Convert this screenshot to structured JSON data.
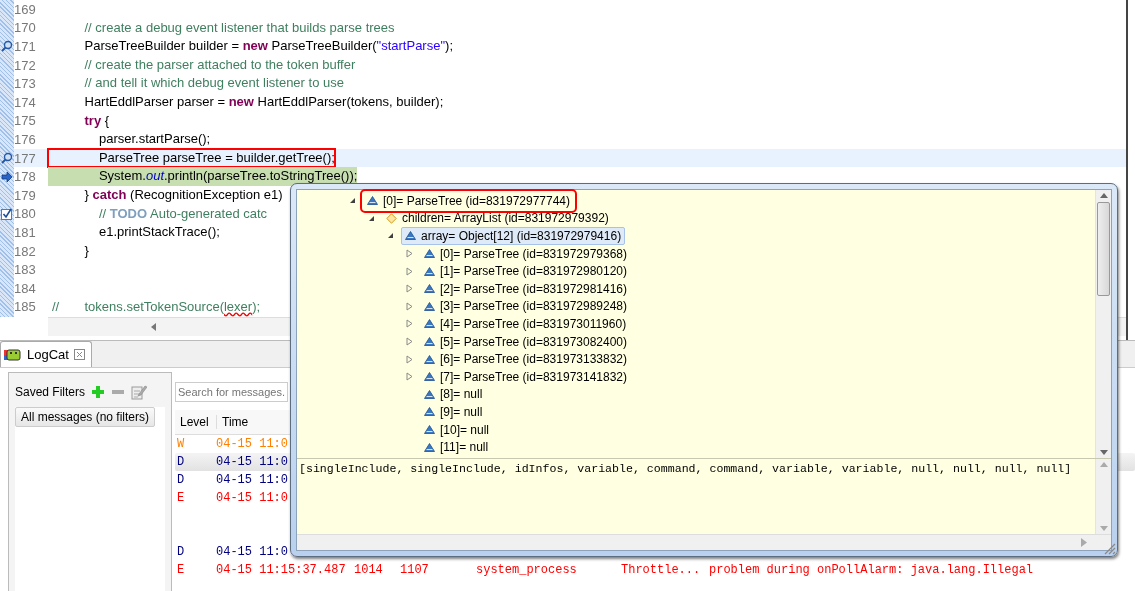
{
  "editor": {
    "lines": [
      {
        "number": "169",
        "kind": "plain",
        "cursor_line": false
      },
      {
        "number": "170",
        "kind": "plain",
        "cursor_line": false,
        "execution_line": false,
        "annotated": false,
        "tokens": [
          {
            "text": "         // create a debug event listener that builds parse trees",
            "kind": "comment"
          }
        ]
      },
      {
        "number": "171",
        "kind": "breakpoint",
        "cursor_line": false,
        "execution_line": false,
        "annotated": false,
        "tokens": [
          {
            "text": "         ParseTreeBuilder builder = ",
            "kind": "plain"
          },
          {
            "text": "new",
            "kind": "keyword"
          },
          {
            "text": " ParseTreeBuilder(",
            "kind": "plain"
          },
          {
            "text": "\"startParse\"",
            "kind": "string"
          },
          {
            "text": ");",
            "kind": "plain"
          }
        ]
      },
      {
        "number": "172",
        "kind": "plain",
        "cursor_line": false,
        "execution_line": false,
        "annotated": false,
        "tokens": [
          {
            "text": "         // create the parser attached to the token buffer",
            "kind": "comment"
          }
        ]
      },
      {
        "number": "173",
        "kind": "plain",
        "cursor_line": false,
        "execution_line": false,
        "annotated": false,
        "tokens": [
          {
            "text": "         // and tell it which debug event listener to use",
            "kind": "comment"
          }
        ]
      },
      {
        "number": "174",
        "kind": "plain",
        "cursor_line": false,
        "execution_line": false,
        "annotated": false,
        "tokens": [
          {
            "text": "         HartEddlParser parser = ",
            "kind": "plain"
          },
          {
            "text": "new",
            "kind": "keyword"
          },
          {
            "text": " HartEddlParser(tokens, builder);",
            "kind": "plain"
          }
        ]
      },
      {
        "number": "175",
        "kind": "plain",
        "cursor_line": false,
        "execution_line": false,
        "annotated": false,
        "tokens": [
          {
            "text": "         try",
            "kind": "keyword"
          },
          {
            "text": " {",
            "kind": "plain"
          }
        ]
      },
      {
        "number": "176",
        "kind": "plain",
        "cursor_line": false,
        "execution_line": false,
        "annotated": false,
        "tokens": [
          {
            "text": "             parser.startParse();",
            "kind": "plain"
          }
        ]
      },
      {
        "number": "177",
        "kind": "breakpoint",
        "cursor_line": true,
        "execution_line": false,
        "annotated": true,
        "tokens": [
          {
            "text": "             ParseTree parseTree = builder.getTree();",
            "kind": "plain"
          }
        ]
      },
      {
        "number": "178",
        "kind": "instruction_pointer",
        "cursor_line": false,
        "execution_line": true,
        "annotated": false,
        "tokens": [
          {
            "text": "             System.",
            "kind": "plain"
          },
          {
            "text": "out",
            "kind": "static_field"
          },
          {
            "text": ".println(parseTree.toStringTree());",
            "kind": "plain"
          }
        ]
      },
      {
        "number": "179",
        "kind": "plain",
        "cursor_line": false,
        "execution_line": false,
        "annotated": false,
        "tokens": [
          {
            "text": "         } ",
            "kind": "plain"
          },
          {
            "text": "catch",
            "kind": "keyword"
          },
          {
            "text": " (RecognitionException e1)",
            "kind": "plain"
          }
        ]
      },
      {
        "number": "180",
        "kind": "task",
        "cursor_line": false,
        "execution_line": false,
        "annotated": false,
        "tokens": [
          {
            "text": "             // ",
            "kind": "comment"
          },
          {
            "text": "TODO",
            "kind": "todo"
          },
          {
            "text": " Auto-generated catc",
            "kind": "comment"
          }
        ]
      },
      {
        "number": "181",
        "kind": "plain",
        "cursor_line": false,
        "execution_line": false,
        "annotated": false,
        "tokens": [
          {
            "text": "             e1.printStackTrace();",
            "kind": "plain"
          }
        ]
      },
      {
        "number": "182",
        "kind": "plain",
        "cursor_line": false,
        "execution_line": false,
        "annotated": false,
        "tokens": [
          {
            "text": "         }",
            "kind": "plain"
          }
        ]
      },
      {
        "number": "183",
        "kind": "plain",
        "cursor_line": false
      },
      {
        "number": "184",
        "kind": "plain",
        "cursor_line": false
      },
      {
        "number": "185",
        "kind": "plain",
        "cursor_line": false,
        "execution_line": false,
        "annotated": false,
        "tokens": [
          {
            "text": "//       tokens.setTokenSource(",
            "kind": "comment"
          },
          {
            "text": "lexer",
            "kind": "comment_warning"
          },
          {
            "text": ");",
            "kind": "comment"
          }
        ]
      }
    ]
  },
  "logcat": {
    "tab": {
      "label": "LogCat"
    },
    "filters": {
      "title": "Saved Filters",
      "items": [
        {
          "label": "All messages (no filters)",
          "selected": true
        }
      ]
    },
    "search": {
      "placeholder": "Search for messages."
    },
    "columns": [
      "Level",
      "Time"
    ],
    "rows": [
      {
        "kind": "entry",
        "level": "W",
        "time": "04-15 11:0",
        "color": "#ff8000",
        "selected": false
      },
      {
        "kind": "entry",
        "level": "D",
        "time": "04-15 11:0",
        "color": "#00007f",
        "selected": true
      },
      {
        "kind": "entry",
        "level": "D",
        "time": "04-15 11:0",
        "color": "#00007f",
        "selected": false
      },
      {
        "kind": "entry",
        "level": "E",
        "time": "04-15 11:0",
        "color": "#ff0000",
        "selected": false
      },
      {
        "kind": "blank"
      },
      {
        "kind": "blank"
      },
      {
        "kind": "entry",
        "level": "D",
        "time": "04-15 11:0",
        "color": "#00007f",
        "selected": false
      },
      {
        "kind": "full",
        "level": "E",
        "time": "04-15 11:15:37.487",
        "pid": "1014",
        "tid": "1107",
        "application": "system_process",
        "tag": "Throttle...",
        "text": "problem during onPollAlarm: java.lang.Illegal",
        "color": "#ff0000",
        "selected": false
      }
    ]
  },
  "inspector": {
    "tree": [
      {
        "label": "[0]= ParseTree  (id=831972977744)",
        "kind": "public",
        "expandable": true,
        "expanded": true,
        "selected": false,
        "annotated": true,
        "children": [
          {
            "label": "children= ArrayList  (id=831972979392)",
            "kind": "protected",
            "expandable": true,
            "expanded": true,
            "selected": false,
            "annotated": false,
            "children": [
              {
                "label": "array= Object[12]  (id=831972979416)",
                "kind": "public",
                "expandable": true,
                "expanded": true,
                "selected": true,
                "annotated": false,
                "children": [
                  {
                    "label": "[0]= ParseTree  (id=831972979368)",
                    "kind": "public",
                    "expandable": true,
                    "expanded": false,
                    "selected": false,
                    "annotated": false
                  },
                  {
                    "label": "[1]= ParseTree  (id=831972980120)",
                    "kind": "public",
                    "expandable": true,
                    "expanded": false,
                    "selected": false,
                    "annotated": false
                  },
                  {
                    "label": "[2]= ParseTree  (id=831972981416)",
                    "kind": "public",
                    "expandable": true,
                    "expanded": false,
                    "selected": false,
                    "annotated": false
                  },
                  {
                    "label": "[3]= ParseTree  (id=831972989248)",
                    "kind": "public",
                    "expandable": true,
                    "expanded": false,
                    "selected": false,
                    "annotated": false
                  },
                  {
                    "label": "[4]= ParseTree  (id=831973011960)",
                    "kind": "public",
                    "expandable": true,
                    "expanded": false,
                    "selected": false,
                    "annotated": false
                  },
                  {
                    "label": "[5]= ParseTree  (id=831973082400)",
                    "kind": "public",
                    "expandable": true,
                    "expanded": false,
                    "selected": false,
                    "annotated": false
                  },
                  {
                    "label": "[6]= ParseTree  (id=831973133832)",
                    "kind": "public",
                    "expandable": true,
                    "expanded": false,
                    "selected": false,
                    "annotated": false
                  },
                  {
                    "label": "[7]= ParseTree  (id=831973141832)",
                    "kind": "public",
                    "expandable": true,
                    "expanded": false,
                    "selected": false,
                    "annotated": false
                  },
                  {
                    "label": "[8]= null",
                    "kind": "public",
                    "expandable": false,
                    "selected": false,
                    "annotated": false
                  },
                  {
                    "label": "[9]= null",
                    "kind": "public",
                    "expandable": false,
                    "selected": false,
                    "annotated": false
                  },
                  {
                    "label": "[10]= null",
                    "kind": "public",
                    "expandable": false,
                    "selected": false,
                    "annotated": false
                  },
                  {
                    "label": "[11]= null",
                    "kind": "public",
                    "expandable": false,
                    "selected": false,
                    "annotated": false
                  }
                ]
              }
            ]
          }
        ]
      }
    ],
    "detail": "[singleInclude, singleInclude, idInfos, variable, command, command, variable, variable, null, null, null, null]"
  }
}
